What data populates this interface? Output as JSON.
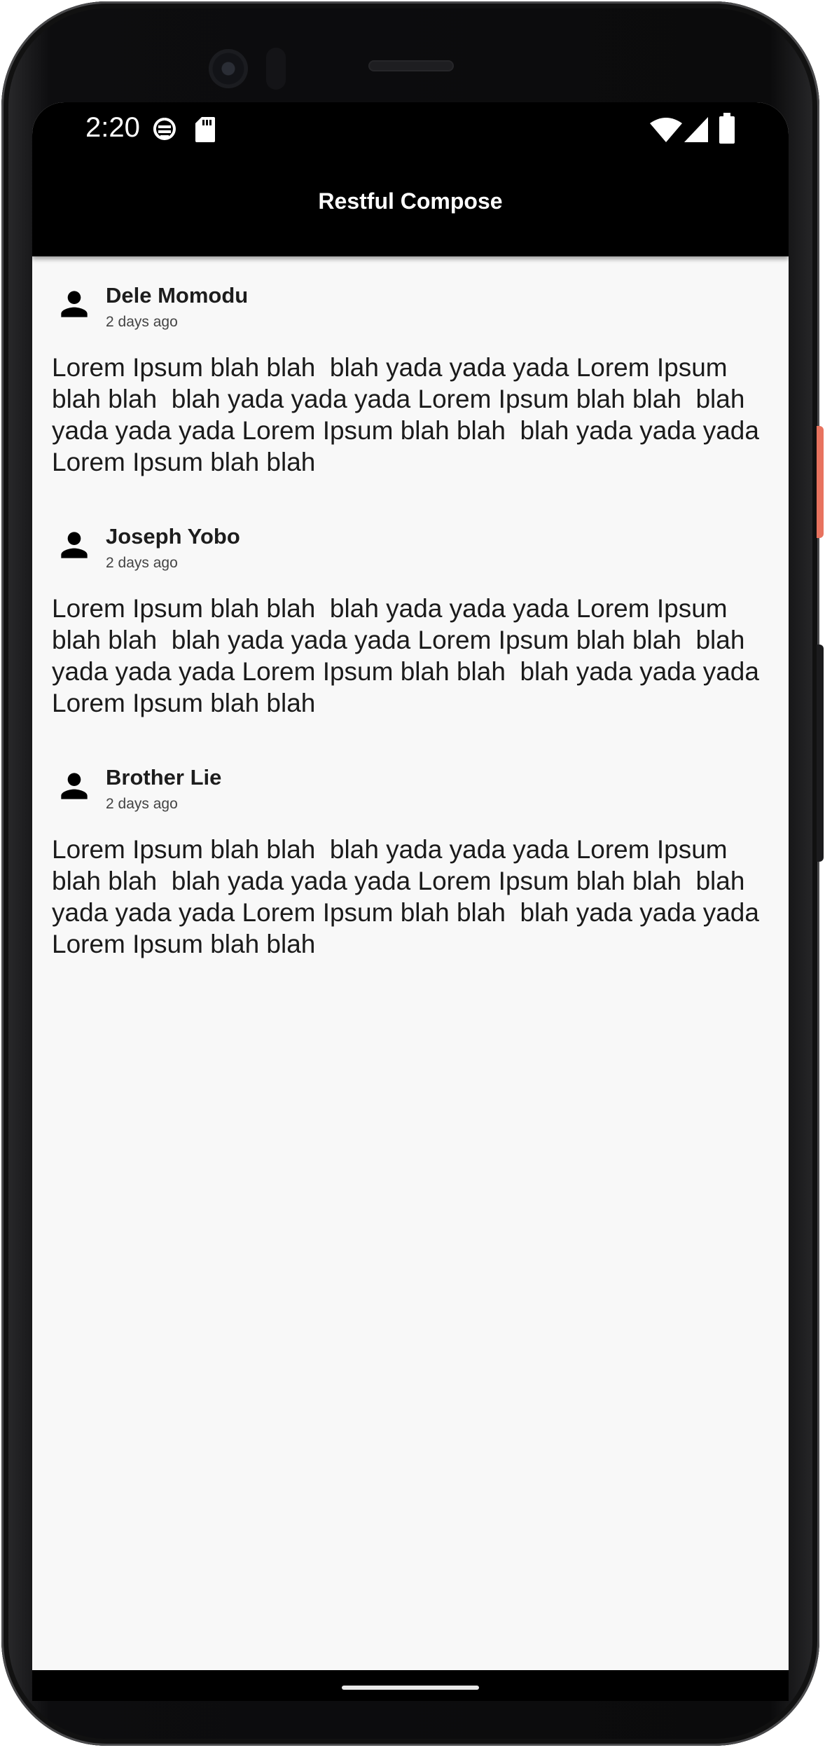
{
  "status_bar": {
    "time": "2:20",
    "icons_left": [
      "data-saver-icon",
      "sd-card-icon"
    ],
    "icons_right": [
      "wifi-icon",
      "signal-icon",
      "battery-icon"
    ]
  },
  "app_bar": {
    "title": "Restful Compose"
  },
  "posts": [
    {
      "author": "Dele Momodu",
      "time_ago": "2 days ago",
      "body": "Lorem Ipsum blah blah  blah yada yada yada Lorem Ipsum\nblah blah  blah yada yada yada Lorem Ipsum blah blah  blah\nyada yada yada Lorem Ipsum blah blah  blah yada yada yada\nLorem Ipsum blah blah",
      "avatar_icon": "person-icon"
    },
    {
      "author": "Joseph Yobo",
      "time_ago": "2 days ago",
      "body": "Lorem Ipsum blah blah  blah yada yada yada Lorem Ipsum\nblah blah  blah yada yada yada Lorem Ipsum blah blah  blah\nyada yada yada Lorem Ipsum blah blah  blah yada yada yada\nLorem Ipsum blah blah",
      "avatar_icon": "person-icon"
    },
    {
      "author": "Brother Lie",
      "time_ago": "2 days ago",
      "body": "Lorem Ipsum blah blah  blah yada yada yada Lorem Ipsum\nblah blah  blah yada yada yada Lorem Ipsum blah blah  blah\nyada yada yada Lorem Ipsum blah blah  blah yada yada yada\nLorem Ipsum blah blah",
      "avatar_icon": "person-icon"
    }
  ],
  "colors": {
    "app_bar": "#000000",
    "screen_background": "#f8f8f8",
    "text": "#1b1b1b"
  }
}
